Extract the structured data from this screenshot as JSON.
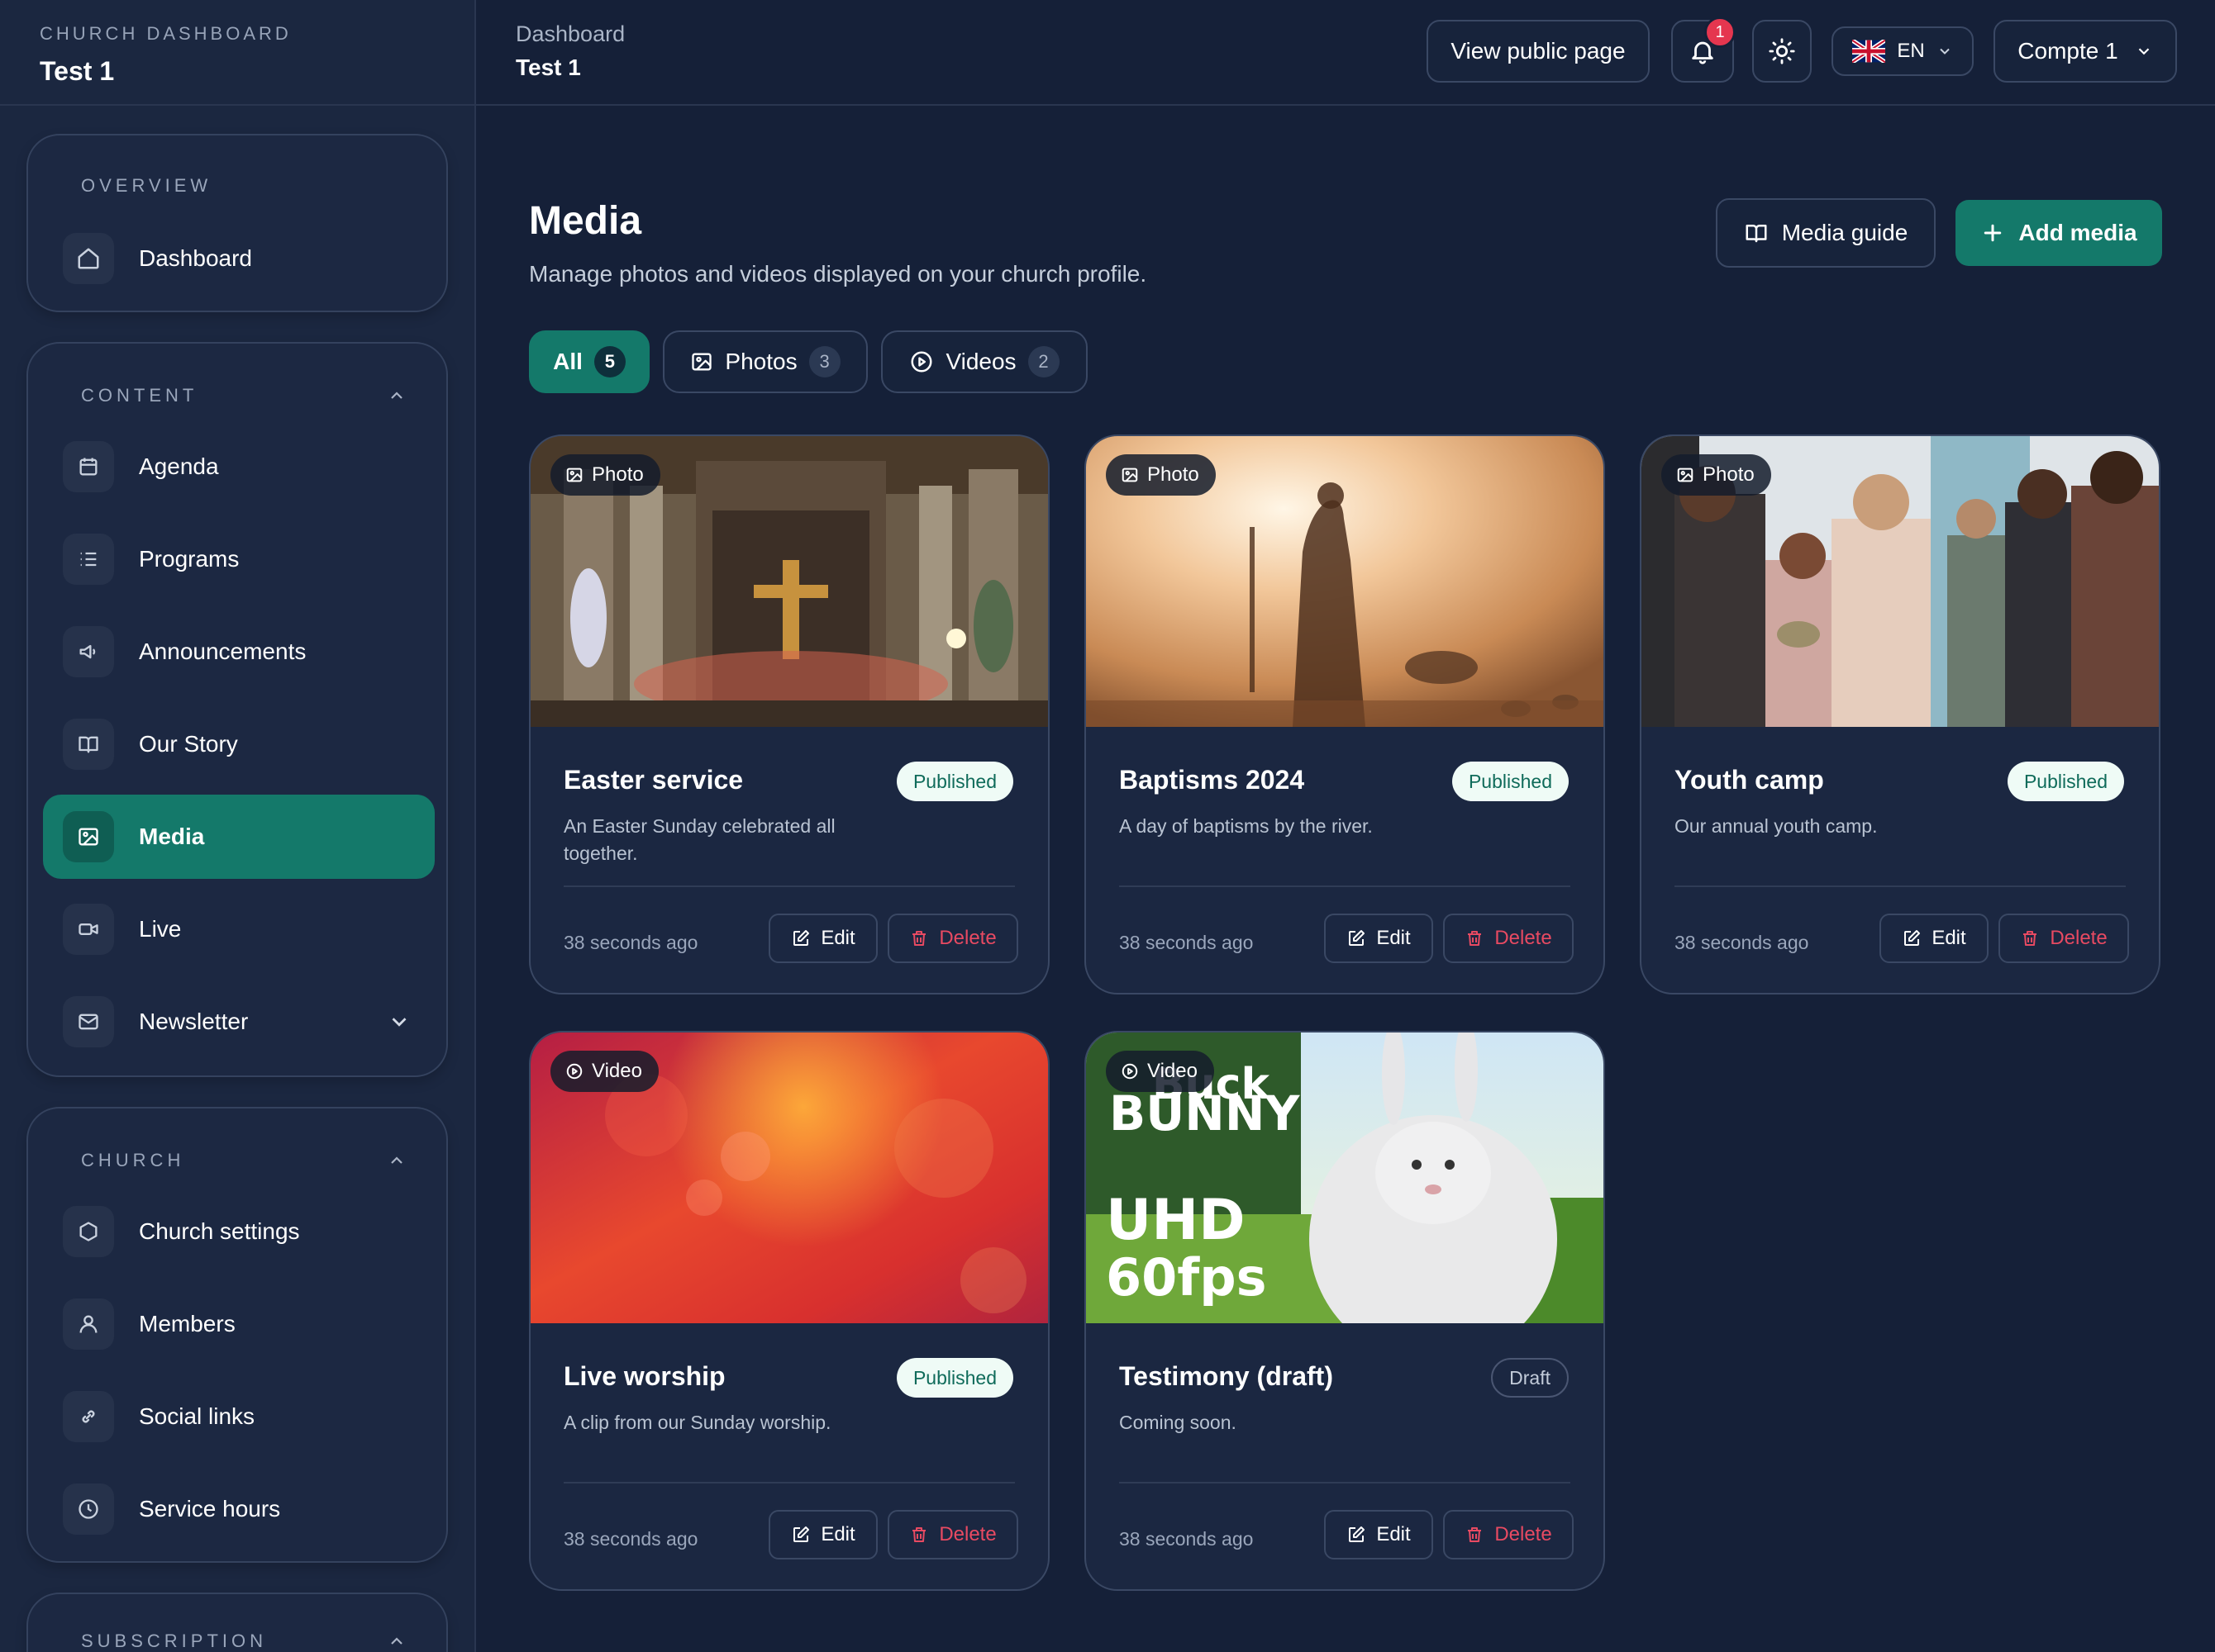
{
  "brand": {
    "kicker": "CHURCH DASHBOARD",
    "title": "Test 1"
  },
  "sidebar": {
    "overview": {
      "label": "OVERVIEW",
      "items": [
        {
          "label": "Dashboard",
          "icon": "home-icon"
        }
      ]
    },
    "content": {
      "label": "CONTENT",
      "items": [
        {
          "label": "Agenda",
          "icon": "calendar-icon"
        },
        {
          "label": "Programs",
          "icon": "list-icon"
        },
        {
          "label": "Announcements",
          "icon": "megaphone-icon"
        },
        {
          "label": "Our Story",
          "icon": "book-icon"
        },
        {
          "label": "Media",
          "icon": "image-icon",
          "active": true
        },
        {
          "label": "Live",
          "icon": "video-camera-icon"
        },
        {
          "label": "Newsletter",
          "icon": "mail-icon"
        }
      ]
    },
    "church": {
      "label": "CHURCH",
      "items": [
        {
          "label": "Church settings",
          "icon": "hexagon-icon"
        },
        {
          "label": "Members",
          "icon": "user-icon"
        },
        {
          "label": "Social links",
          "icon": "link-icon"
        },
        {
          "label": "Service hours",
          "icon": "clock-icon"
        }
      ]
    },
    "subscription": {
      "label": "SUBSCRIPTION"
    }
  },
  "topbar": {
    "breadcrumb": "Dashboard",
    "title": "Test 1",
    "view_public": "View public page",
    "notifications_count": "1",
    "language": "EN",
    "account": "Compte 1"
  },
  "main": {
    "title": "Media",
    "subtitle": "Manage photos and videos displayed on your church profile.",
    "guide_button": "Media guide",
    "add_button": "Add media",
    "filters": [
      {
        "label": "All",
        "count": "5"
      },
      {
        "label": "Photos",
        "count": "3"
      },
      {
        "label": "Videos",
        "count": "2"
      }
    ]
  },
  "cards": [
    {
      "type": "Photo",
      "title": "Easter service",
      "status": "Published",
      "desc": "An Easter Sunday celebrated all together.",
      "time": "38 seconds ago",
      "edit": "Edit",
      "delete": "Delete"
    },
    {
      "type": "Photo",
      "title": "Baptisms 2024",
      "status": "Published",
      "desc": "A day of baptisms by the river.",
      "time": "38 seconds ago",
      "edit": "Edit",
      "delete": "Delete"
    },
    {
      "type": "Photo",
      "title": "Youth camp",
      "status": "Published",
      "desc": "Our annual youth camp.",
      "time": "38 seconds ago",
      "edit": "Edit",
      "delete": "Delete"
    },
    {
      "type": "Video",
      "title": "Live worship",
      "status": "Published",
      "desc": "A clip from our Sunday worship.",
      "time": "38 seconds ago",
      "edit": "Edit",
      "delete": "Delete"
    },
    {
      "type": "Video",
      "title": "Testimony (draft)",
      "status": "Draft",
      "desc": "Coming soon.",
      "time": "38 seconds ago",
      "edit": "Edit",
      "delete": "Delete",
      "thumb_text": [
        "Buck",
        "BUNNY",
        "UHD",
        "60fps"
      ]
    }
  ],
  "colors": {
    "accent": "#14796a",
    "danger": "#e84a62",
    "background": "#152038",
    "card": "#1b2741"
  }
}
